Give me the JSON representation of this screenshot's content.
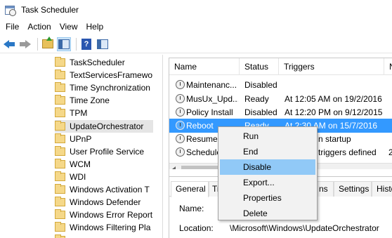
{
  "window": {
    "title": "Task Scheduler"
  },
  "menu": [
    "File",
    "Action",
    "View",
    "Help"
  ],
  "toolbar": {
    "help_glyph": "?"
  },
  "tree": {
    "items": [
      "TaskScheduler",
      "TextServicesFramewo",
      "Time Synchronization",
      "Time Zone",
      "TPM",
      "UpdateOrchestrator",
      "UPnP",
      "User Profile Service",
      "WCM",
      "WDI",
      "Windows Activation T",
      "Windows Defender",
      "Windows Error Report",
      "Windows Filtering Pla"
    ],
    "selected": "UpdateOrchestrator"
  },
  "tasklist": {
    "columns": [
      "Name",
      "Status",
      "Triggers",
      "N"
    ],
    "rows": [
      {
        "name": "Maintenanc...",
        "status": "Disabled",
        "triggers": ""
      },
      {
        "name": "MusUx_Upd...",
        "status": "Ready",
        "triggers": "At 12:05 AM on 19/2/2016"
      },
      {
        "name": "Policy Install",
        "status": "Disabled",
        "triggers": "At 12:20 PM on 9/12/2015"
      },
      {
        "name": "Reboot",
        "status": "Ready",
        "triggers": "At 2:30 AM on 15/7/2016"
      },
      {
        "name": "Resume",
        "status": "",
        "triggers": "n startup"
      },
      {
        "name": "Schedule",
        "status": "",
        "triggers": "triggers defined",
        "extra": "2"
      }
    ],
    "selected_row": "Reboot"
  },
  "detail": {
    "tabs": [
      "General",
      "Tr",
      "ns",
      "Settings",
      "Histo"
    ],
    "active_tab": "General",
    "name_label": "Name:",
    "location_label": "Location:",
    "location_value": "\\Microsoft\\Windows\\UpdateOrchestrator"
  },
  "context_menu": {
    "items": [
      "Run",
      "End",
      "Disable",
      "Export...",
      "Properties",
      "Delete"
    ],
    "highlighted": "Disable"
  },
  "colors": {
    "selection": "#3399ff",
    "menu_hover": "#91c9f7",
    "folder": "#f5d889"
  }
}
